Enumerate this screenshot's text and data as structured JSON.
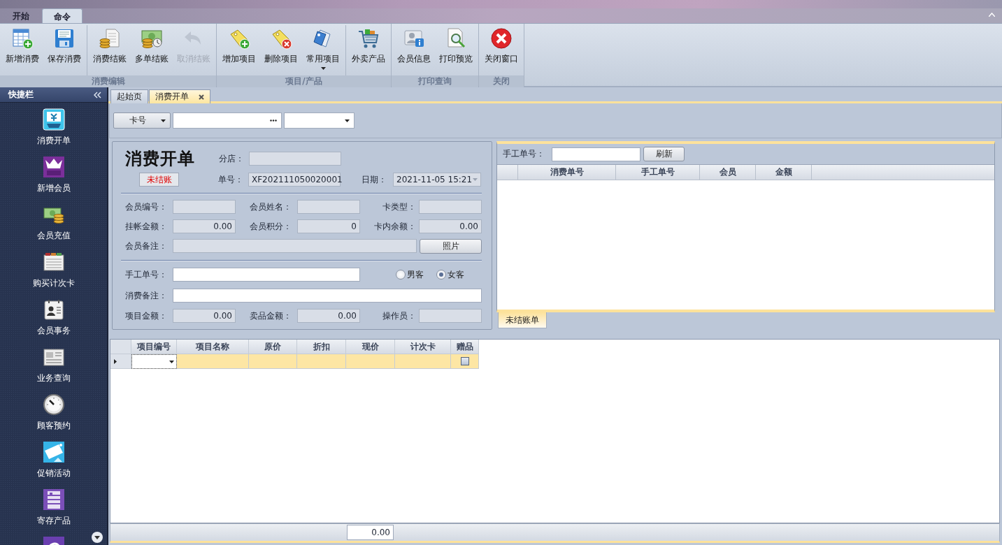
{
  "ribbon": {
    "tabs": [
      {
        "label": "开始",
        "selected": false
      },
      {
        "label": "命令",
        "selected": true
      }
    ],
    "groups": [
      {
        "label": "消费编辑",
        "sets": [
          [
            {
              "label": "新增消费",
              "disabled": false,
              "menu": false
            },
            {
              "label": "保存消费",
              "disabled": false,
              "menu": false
            }
          ],
          [
            {
              "label": "消费结账",
              "disabled": false,
              "menu": false
            },
            {
              "label": "多单结账",
              "disabled": false,
              "menu": false
            },
            {
              "label": "取消结账",
              "disabled": true,
              "menu": false
            }
          ]
        ]
      },
      {
        "label": "项目/产品",
        "sets": [
          [
            {
              "label": "增加项目",
              "disabled": false,
              "menu": false
            },
            {
              "label": "删除项目",
              "disabled": false,
              "menu": false
            },
            {
              "label": "常用项目",
              "disabled": false,
              "menu": true
            }
          ],
          [
            {
              "label": "外卖产品",
              "disabled": false,
              "menu": false
            }
          ]
        ]
      },
      {
        "label": "打印查询",
        "sets": [
          [
            {
              "label": "会员信息",
              "disabled": false,
              "menu": false
            },
            {
              "label": "打印预览",
              "disabled": false,
              "menu": false
            }
          ]
        ]
      },
      {
        "label": "关闭",
        "sets": [
          [
            {
              "label": "关闭窗口",
              "disabled": false,
              "menu": false
            }
          ]
        ]
      }
    ]
  },
  "sidebar": {
    "title": "快捷栏",
    "items": [
      {
        "label": "消费开单"
      },
      {
        "label": "新增会员"
      },
      {
        "label": "会员充值"
      },
      {
        "label": "购买计次卡"
      },
      {
        "label": "会员事务"
      },
      {
        "label": "业务查询"
      },
      {
        "label": "顾客预约"
      },
      {
        "label": "促销活动"
      },
      {
        "label": "寄存产品"
      }
    ]
  },
  "doc_tabs": [
    {
      "label": "起始页",
      "selected": false,
      "closable": false
    },
    {
      "label": "消费开单",
      "selected": true,
      "closable": true
    }
  ],
  "search": {
    "mode": "卡号"
  },
  "form": {
    "title": "消费开单",
    "status": "未结账",
    "branch": {
      "label": "分店：",
      "editable": false
    },
    "order_no": {
      "label": "单号：",
      "value": "XF202111050020001",
      "editable": false
    },
    "date": {
      "label": "日期：",
      "value": "2021-11-05 15:21",
      "editable": false
    },
    "member_fields": [
      {
        "label": "会员编号：",
        "editable": false
      },
      {
        "label": "会员姓名：",
        "editable": false
      },
      {
        "label": "卡类型：",
        "editable": false
      },
      {
        "label": "挂帐金额：",
        "value": "0.00",
        "editable": false
      },
      {
        "label": "会员积分：",
        "value": "0",
        "editable": false
      },
      {
        "label": "卡内余额：",
        "value": "0.00",
        "editable": false
      }
    ],
    "member_note": {
      "label": "会员备注：",
      "editable": false
    },
    "photo_button": "照片",
    "manual_no": {
      "label": "手工单号：",
      "editable": true
    },
    "guest_types": [
      {
        "label": "男客",
        "selected": false
      },
      {
        "label": "女客",
        "selected": true
      }
    ],
    "note": {
      "label": "消费备注：",
      "editable": true
    },
    "amount_fields": [
      {
        "label": "项目金额：",
        "value": "0.00",
        "editable": false
      },
      {
        "label": "卖品金额：",
        "value": "0.00",
        "editable": false
      },
      {
        "label": "操作员：",
        "editable": false
      }
    ]
  },
  "orders": {
    "filter_label": "手工单号：",
    "refresh_button": "刷新",
    "columns": [
      "消费单号",
      "手工单号",
      "会员",
      "金额"
    ],
    "tabs": [
      {
        "label": "未结账单",
        "selected": true
      }
    ]
  },
  "items": {
    "columns": [
      "项目编号",
      "项目名称",
      "原价",
      "折扣",
      "现价",
      "计次卡",
      "赠品"
    ],
    "rows": [
      {
        "current": true,
        "gift": false
      }
    ],
    "total": "0.00"
  }
}
